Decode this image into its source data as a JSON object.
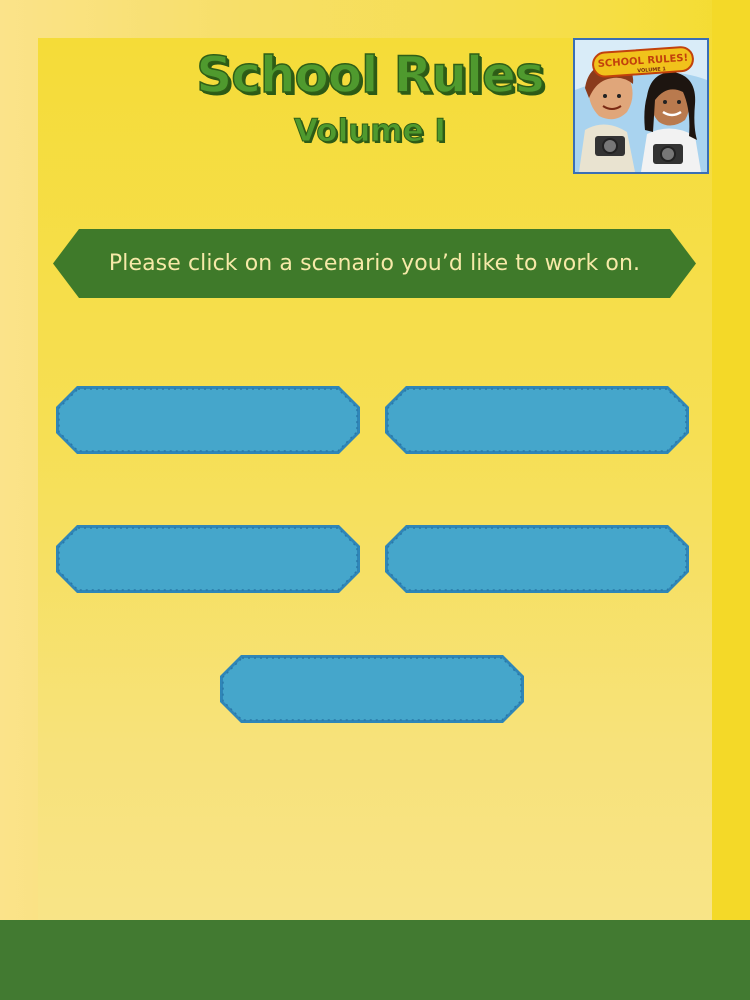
{
  "header": {
    "title": "School Rules",
    "subtitle": "Volume I"
  },
  "cover": {
    "logo_text": "SCHOOL RULES!",
    "logo_subtext": "VOLUME 1"
  },
  "instruction": "Please click on a scenario you’d like to work on.",
  "scenarios": [
    {
      "label": ""
    },
    {
      "label": ""
    },
    {
      "label": ""
    },
    {
      "label": ""
    },
    {
      "label": ""
    }
  ],
  "colors": {
    "page_background": "#f6de45",
    "banner": "#3f7a2a",
    "banner_text": "#f6e9a8",
    "button_fill": "#45a6cb",
    "button_border": "#2f86b8",
    "title_green": "#4f9a2e",
    "footer": "#427a31"
  }
}
